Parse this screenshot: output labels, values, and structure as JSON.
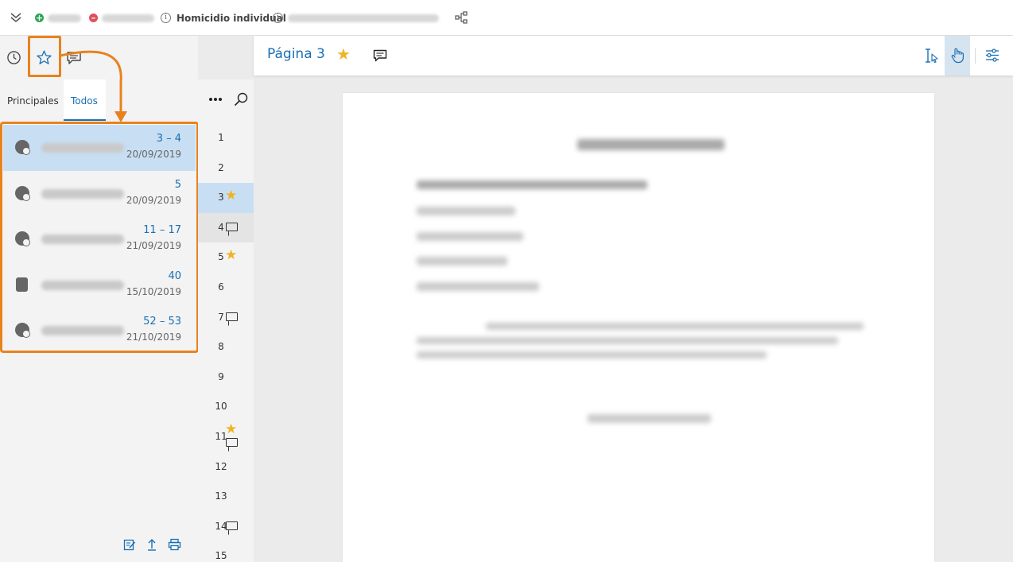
{
  "topbar": {
    "case_title": "Homicidio individual"
  },
  "tabs": [
    {
      "label": "Principales",
      "active": false
    },
    {
      "label": "Todos",
      "active": true
    }
  ],
  "bookmarks": [
    {
      "pages": "3 – 4",
      "date": "20/09/2019",
      "icon": "person-remove-icon",
      "selected": true
    },
    {
      "pages": "5",
      "date": "20/09/2019",
      "icon": "person-remove-icon",
      "selected": false
    },
    {
      "pages": "11 – 17",
      "date": "21/09/2019",
      "icon": "person-remove-icon",
      "selected": false
    },
    {
      "pages": "40",
      "date": "15/10/2019",
      "icon": "document-icon",
      "selected": false
    },
    {
      "pages": "52 – 53",
      "date": "21/10/2019",
      "icon": "person-remove-icon",
      "selected": false
    }
  ],
  "page_strip": [
    {
      "num": "1",
      "star": false,
      "comment": false
    },
    {
      "num": "2",
      "star": false,
      "comment": false
    },
    {
      "num": "3",
      "star": true,
      "comment": false,
      "selected": true
    },
    {
      "num": "4",
      "star": false,
      "comment": true
    },
    {
      "num": "5",
      "star": true,
      "comment": false
    },
    {
      "num": "6",
      "star": false,
      "comment": false
    },
    {
      "num": "7",
      "star": false,
      "comment": true
    },
    {
      "num": "8",
      "star": false,
      "comment": false
    },
    {
      "num": "9",
      "star": false,
      "comment": false
    },
    {
      "num": "10",
      "star": false,
      "comment": false
    },
    {
      "num": "11",
      "star": true,
      "comment": true
    },
    {
      "num": "12",
      "star": false,
      "comment": false
    },
    {
      "num": "13",
      "star": false,
      "comment": false
    },
    {
      "num": "14",
      "star": false,
      "comment": true
    },
    {
      "num": "15",
      "star": false,
      "comment": false
    }
  ],
  "doc_header": {
    "page_title": "Página 3"
  },
  "colors": {
    "accent": "#1a6fb3",
    "highlight": "#e8821e",
    "star": "#f0b323",
    "selected_bg": "#c8dff3",
    "add_green": "#2aa553",
    "remove_red": "#e0505a"
  }
}
